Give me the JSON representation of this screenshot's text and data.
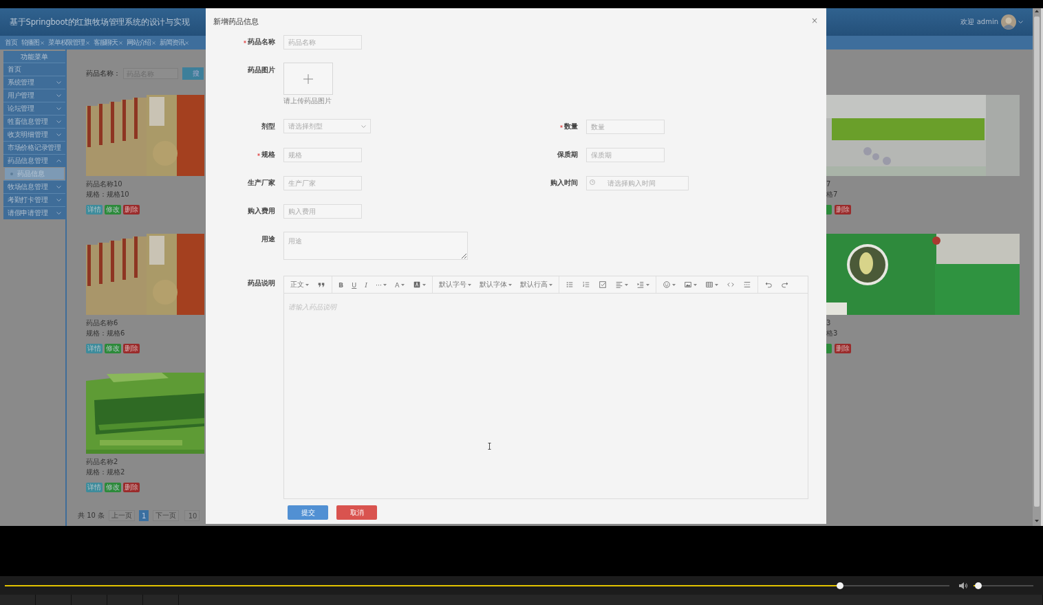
{
  "header": {
    "title": "基于Springboot的红旗牧场管理系统的设计与实现",
    "welcome": "欢迎 admin"
  },
  "tabs": [
    {
      "label": "首页",
      "closable": false
    },
    {
      "label": "轮播图",
      "closable": true
    },
    {
      "label": "菜单权限管理",
      "closable": true
    },
    {
      "label": "客服聊天",
      "closable": true
    },
    {
      "label": "网站介绍",
      "closable": true
    },
    {
      "label": "新闻资讯",
      "closable": true
    }
  ],
  "sidebar": {
    "title": "功能菜单",
    "items": [
      {
        "label": "首页"
      },
      {
        "label": "系统管理",
        "expanded": false
      },
      {
        "label": "用户管理",
        "expanded": false
      },
      {
        "label": "论坛管理",
        "expanded": false
      },
      {
        "label": "牲畜信息管理",
        "expanded": false
      },
      {
        "label": "收支明细管理",
        "expanded": false
      },
      {
        "label": "市场价格记录管理"
      },
      {
        "label": "药品信息管理",
        "expanded": true,
        "children": [
          {
            "label": "药品信息",
            "selected": true
          }
        ]
      },
      {
        "label": "牧场信息管理",
        "expanded": false
      },
      {
        "label": "考勤打卡管理",
        "expanded": false
      },
      {
        "label": "请假申请管理",
        "expanded": false
      }
    ]
  },
  "search": {
    "label": "药品名称：",
    "placeholder": "药品名称",
    "button": "搜"
  },
  "cards_left": [
    {
      "name": "药品名称10",
      "spec": "规格：规格10",
      "buttons": [
        {
          "kind": "detail",
          "label": "详情"
        },
        {
          "kind": "edit",
          "label": "修改"
        },
        {
          "kind": "delete",
          "label": "删除"
        }
      ]
    },
    {
      "name": "药品名称6",
      "spec": "规格：规格6",
      "buttons": [
        {
          "kind": "detail",
          "label": "详情"
        },
        {
          "kind": "edit",
          "label": "修改"
        },
        {
          "kind": "delete",
          "label": "删除"
        }
      ]
    },
    {
      "name": "药品名称2",
      "spec": "规格：规格2",
      "buttons": [
        {
          "kind": "detail",
          "label": "详情"
        },
        {
          "kind": "edit",
          "label": "修改"
        },
        {
          "kind": "delete",
          "label": "删除"
        }
      ]
    }
  ],
  "cards_right": [
    {
      "name": "7",
      "spec": "格7",
      "buttons": [
        {
          "kind": "edit"
        },
        {
          "kind": "delete",
          "label": "删除"
        }
      ]
    },
    {
      "name": "3",
      "spec": "格3",
      "buttons": [
        {
          "kind": "edit"
        },
        {
          "kind": "delete",
          "label": "删除"
        }
      ]
    }
  ],
  "pagination": {
    "total": "共 10 条",
    "prev": "上一页",
    "pages": [
      {
        "label": "1",
        "selected": true
      }
    ],
    "next": "下一页",
    "size": "10"
  },
  "modal": {
    "title": "新增药品信息",
    "close": "×",
    "rows": [
      [
        {
          "label": "药品名称",
          "required": true,
          "kind": "input",
          "placeholder": "药品名称"
        }
      ],
      [
        {
          "label": "药品图片",
          "required": false,
          "kind": "upload",
          "hint": "请上传药品图片"
        }
      ],
      [
        {
          "label": "剂型",
          "required": false,
          "kind": "select",
          "placeholder": "请选择剂型"
        },
        {
          "label": "数量",
          "required": true,
          "kind": "input",
          "placeholder": "数量"
        }
      ],
      [
        {
          "label": "规格",
          "required": true,
          "kind": "input",
          "placeholder": "规格"
        },
        {
          "label": "保质期",
          "required": false,
          "kind": "input",
          "placeholder": "保质期"
        }
      ],
      [
        {
          "label": "生产厂家",
          "required": false,
          "kind": "input",
          "placeholder": "生产厂家"
        },
        {
          "label": "购入时间",
          "required": false,
          "kind": "date",
          "placeholder": "请选择购入时间"
        }
      ],
      [
        {
          "label": "购入费用",
          "required": false,
          "kind": "input",
          "placeholder": "购入费用"
        }
      ],
      [
        {
          "label": "用途",
          "required": false,
          "kind": "textarea",
          "placeholder": "用途"
        }
      ],
      [
        {
          "label": "药品说明",
          "required": false,
          "kind": "editor",
          "placeholder": "请输入药品说明"
        }
      ]
    ],
    "toolbar": [
      [
        {
          "kind": "dropdown",
          "label": "正文"
        },
        {
          "kind": "icon"
        }
      ],
      [
        {
          "kind": "bold",
          "label": "B"
        },
        {
          "kind": "underline",
          "label": "U"
        },
        {
          "kind": "italic",
          "label": "I"
        },
        {
          "kind": "dropdown",
          "label": "···"
        },
        {
          "kind": "dropdown",
          "label": "A"
        },
        {
          "kind": "icondropdown"
        }
      ],
      [
        {
          "kind": "dropdown",
          "label": "默认字号"
        },
        {
          "kind": "dropdown",
          "label": "默认字体"
        },
        {
          "kind": "dropdown",
          "label": "默认行高"
        }
      ],
      [
        {
          "kind": "icon"
        },
        {
          "kind": "icon"
        },
        {
          "kind": "icon"
        },
        {
          "kind": "icondropdown"
        },
        {
          "kind": "icondropdown"
        }
      ],
      [
        {
          "kind": "icondropdown"
        },
        {
          "kind": "icondropdown"
        },
        {
          "kind": "icondropdown"
        },
        {
          "kind": "icon"
        },
        {
          "kind": "icon"
        }
      ],
      [
        {
          "kind": "icon"
        },
        {
          "kind": "icon"
        }
      ]
    ],
    "buttons": [
      {
        "kind": "primary",
        "label": "提交"
      },
      {
        "kind": "danger",
        "label": "取消"
      }
    ]
  },
  "player": {
    "progress": {
      "level": 0.884
    },
    "volume": {
      "level": 0.08
    }
  }
}
